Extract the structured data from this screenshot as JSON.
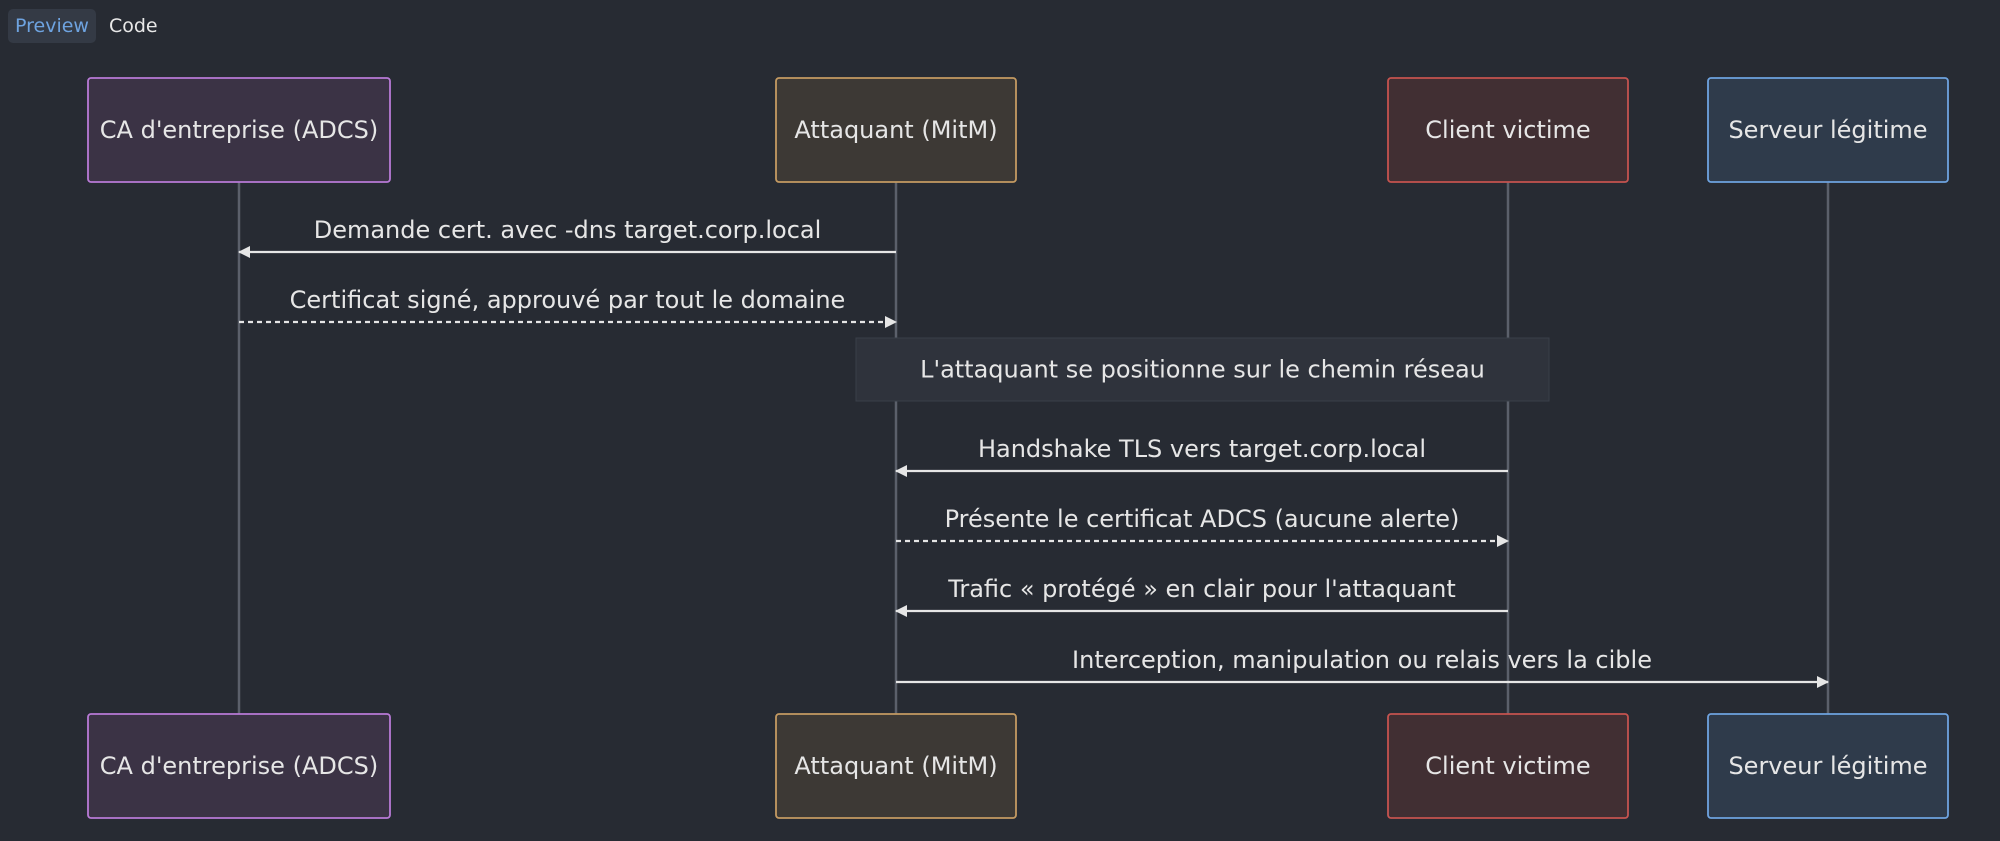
{
  "tabs": [
    {
      "label": "Preview",
      "active": true
    },
    {
      "label": "Code",
      "active": false
    }
  ],
  "participants": [
    {
      "id": "ca",
      "label": "CA d'entreprise (ADCS)",
      "fill": "#3b3345",
      "stroke": "#b87ad6"
    },
    {
      "id": "attacker",
      "label": "Attaquant (MitM)",
      "fill": "#3d3935",
      "stroke": "#c49a62"
    },
    {
      "id": "client",
      "label": "Client victime",
      "fill": "#412f33",
      "stroke": "#c5534f"
    },
    {
      "id": "server",
      "label": "Serveur légitime",
      "fill": "#2f3b4b",
      "stroke": "#6ea3e0"
    }
  ],
  "messages": [
    {
      "from": "attacker",
      "to": "ca",
      "label": "Demande cert. avec -dns target.corp.local",
      "style": "solid"
    },
    {
      "from": "ca",
      "to": "attacker",
      "label": "Certificat signé, approuvé par tout le domaine",
      "style": "dashed"
    },
    {
      "note": true,
      "over": [
        "attacker",
        "client"
      ],
      "label": "L'attaquant se positionne sur le chemin réseau"
    },
    {
      "from": "client",
      "to": "attacker",
      "label": "Handshake TLS vers target.corp.local",
      "style": "solid"
    },
    {
      "from": "attacker",
      "to": "client",
      "label": "Présente le certificat ADCS (aucune alerte)",
      "style": "dashed"
    },
    {
      "from": "client",
      "to": "attacker",
      "label": "Trafic « protégé » en clair pour l'attaquant",
      "style": "solid"
    },
    {
      "from": "attacker",
      "to": "server",
      "label": "Interception, manipulation ou relais vers la cible",
      "style": "solid"
    }
  ],
  "colors": {
    "background": "#272b33",
    "lifeline": "#5b606b",
    "arrow": "#e6e6e6",
    "text": "#e6e6e6",
    "note_fill": "#2f333c",
    "note_stroke": "#3a3f49"
  }
}
